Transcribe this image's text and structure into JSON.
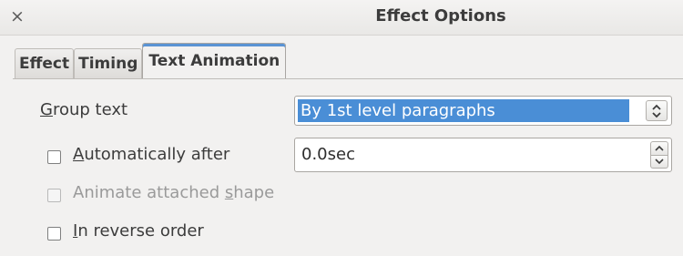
{
  "window": {
    "title": "Effect Options",
    "close_glyph": "×"
  },
  "tabs": [
    {
      "label": "Effect",
      "active": false
    },
    {
      "label": "Timing",
      "active": false
    },
    {
      "label": "Text Animation",
      "active": true
    }
  ],
  "group_text": {
    "label_mnemonic": "G",
    "label_rest": "roup text",
    "value": "By 1st level paragraphs"
  },
  "auto_after": {
    "label_mnemonic": "A",
    "label_rest": "utomatically after",
    "checked": false,
    "value": "0.0sec"
  },
  "animate_shape": {
    "label_before": "Animate attached ",
    "label_mnemonic": "s",
    "label_after": "hape",
    "checked": false,
    "enabled": false
  },
  "reverse_order": {
    "label_mnemonic": "I",
    "label_rest": "n reverse order",
    "checked": false
  },
  "colors": {
    "selection": "#4a8ed6",
    "active_tab_accent": "#5a93d4"
  }
}
